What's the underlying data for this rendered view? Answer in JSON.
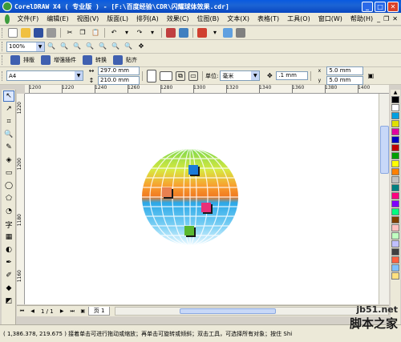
{
  "window": {
    "title": "CorelDRAW X4 ( 专业版 ) - [F:\\百度经验\\CDR\\闪耀球体效果.cdr]"
  },
  "menu": {
    "items": [
      "文件(F)",
      "编辑(E)",
      "视图(V)",
      "版面(L)",
      "排列(A)",
      "效果(C)",
      "位图(B)",
      "文本(X)",
      "表格(T)",
      "工具(O)",
      "窗口(W)",
      "帮助(H)"
    ]
  },
  "toolbar": {
    "zoom_value": "100%"
  },
  "text_toolbar": {
    "typeset_label": "排版",
    "enhance_label": "增强插件",
    "convert_label": "转换",
    "stick_label": "贴齐"
  },
  "property_bar": {
    "paper_size": "A4",
    "width": "297.0 mm",
    "height": "210.0 mm",
    "unit_label": "单位:",
    "unit_value": "毫米",
    "nudge": ".1 mm",
    "dup_x": "5.0 mm",
    "dup_y": "5.0 mm"
  },
  "ruler": {
    "ticks_top": [
      "1200",
      "1220",
      "1240",
      "1260",
      "1280",
      "1300",
      "1320",
      "1340",
      "1360",
      "1380",
      "1400"
    ],
    "ticks_left": [
      "1220",
      "1200",
      "1180",
      "1160"
    ]
  },
  "palette": {
    "colors": [
      "#000000",
      "#ffffff",
      "#00a0e0",
      "#e0e000",
      "#e000a0",
      "#0000c0",
      "#c00000",
      "#00a000",
      "#ffff00",
      "#ff8000",
      "#c0c0c0",
      "#008080",
      "#ff0080",
      "#8000ff",
      "#00ff80",
      "#804000",
      "#ffc0c0",
      "#c0ffc0",
      "#c0c0ff",
      "#404040",
      "#ff6040",
      "#80c0ff",
      "#ffe080"
    ]
  },
  "page_nav": {
    "page_counter": "1 / 1",
    "page_tab": "页 1"
  },
  "status": {
    "text": "( 1,386.378, 219.675 )  接着单击可进行拖动或缩放；再单击可旋转或倾斜；双击工具，可选择所有对象；按住 Shi..."
  },
  "watermark": {
    "url": "jb51.net",
    "name": "脚本之家"
  }
}
